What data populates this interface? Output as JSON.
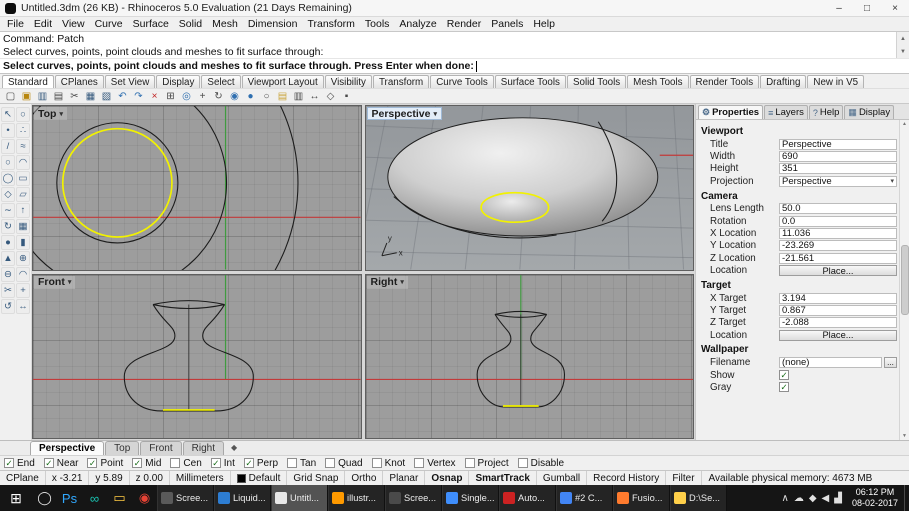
{
  "colors": {
    "selection": "#f2f200",
    "axis_x": "#c23a3a",
    "axis_y": "#3f9b3f",
    "curve": "#1c1c1c",
    "taskbar_bg": "#151515",
    "accent": "#2f6fb0"
  },
  "icons": {
    "check": "✓",
    "chevron_down": "▾",
    "scroll_up": "▲",
    "scroll_down": "▼",
    "viewport_menu": "◆"
  },
  "titlebar": {
    "title": "Untitled.3dm (26 KB) - Rhinoceros 5.0 Evaluation (21 Days Remaining)",
    "minimize": "–",
    "maximize": "□",
    "close": "×"
  },
  "menubar": {
    "items": [
      "File",
      "Edit",
      "View",
      "Curve",
      "Surface",
      "Solid",
      "Mesh",
      "Dimension",
      "Transform",
      "Tools",
      "Analyze",
      "Render",
      "Panels",
      "Help"
    ]
  },
  "command": {
    "history": [
      "Command: Patch",
      "Select curves, points, point clouds and meshes to fit surface through:"
    ],
    "prompt": "Select curves, points, point clouds and meshes to fit surface through. Press Enter when done:"
  },
  "toolbar_tabs": {
    "active": "Standard",
    "items": [
      "Standard",
      "CPlanes",
      "Set View",
      "Display",
      "Select",
      "Viewport Layout",
      "Visibility",
      "Transform",
      "Curve Tools",
      "Surface Tools",
      "Solid Tools",
      "Mesh Tools",
      "Render Tools",
      "Drafting",
      "New in V5"
    ]
  },
  "toolbar": {
    "icons": [
      {
        "name": "new-file",
        "glyph": "▢",
        "color": "#4a4a4a"
      },
      {
        "name": "open-file",
        "glyph": "▣",
        "color": "#b8860b"
      },
      {
        "name": "save-file",
        "glyph": "▥",
        "color": "#35597d"
      },
      {
        "name": "print",
        "glyph": "▤",
        "color": "#4a4a4a"
      },
      {
        "name": "cut",
        "glyph": "✂",
        "color": "#4a4a4a"
      },
      {
        "name": "copy",
        "glyph": "▦",
        "color": "#35597d"
      },
      {
        "name": "paste",
        "glyph": "▧",
        "color": "#35597d"
      },
      {
        "name": "undo",
        "glyph": "↶",
        "color": "#2f6fb0"
      },
      {
        "name": "redo",
        "glyph": "↷",
        "color": "#2f6fb0"
      },
      {
        "name": "delete",
        "glyph": "×",
        "color": "#c22525"
      },
      {
        "name": "select-all",
        "glyph": "⊞",
        "color": "#4a4a4a"
      },
      {
        "name": "zoom-extents",
        "glyph": "◎",
        "color": "#2f6fb0"
      },
      {
        "name": "pan-view",
        "glyph": "+",
        "color": "#4a4a4a"
      },
      {
        "name": "rotate-view",
        "glyph": "↻",
        "color": "#4a4a4a"
      },
      {
        "name": "zoom-window",
        "glyph": "◉",
        "color": "#2f6fb0"
      },
      {
        "name": "shaded-view",
        "glyph": "●",
        "color": "#2f6fb0"
      },
      {
        "name": "wireframe-view",
        "glyph": "○",
        "color": "#4a4a4a"
      },
      {
        "name": "layers-dialog",
        "glyph": "▤",
        "color": "#caa53d"
      },
      {
        "name": "object-properties",
        "glyph": "▥",
        "color": "#4a4a4a"
      },
      {
        "name": "distance",
        "glyph": "↔",
        "color": "#4a4a4a"
      },
      {
        "name": "hide-objects",
        "glyph": "◇",
        "color": "#4a4a4a"
      },
      {
        "name": "lock-objects",
        "glyph": "▪",
        "color": "#4a4a4a"
      }
    ]
  },
  "sidebar": {
    "tools": [
      {
        "name": "pointer-tool",
        "glyph": "↖"
      },
      {
        "name": "selection-filter-tool",
        "glyph": "○"
      },
      {
        "name": "point-tool",
        "glyph": "•"
      },
      {
        "name": "points-tool",
        "glyph": "∴"
      },
      {
        "name": "polyline-tool",
        "glyph": "/"
      },
      {
        "name": "curve-tool",
        "glyph": "≈"
      },
      {
        "name": "circle-tool",
        "glyph": "○"
      },
      {
        "name": "arc-tool",
        "glyph": "◠"
      },
      {
        "name": "ellipse-tool",
        "glyph": "◯"
      },
      {
        "name": "rectangle-tool",
        "glyph": "▭"
      },
      {
        "name": "polygon-tool",
        "glyph": "◇"
      },
      {
        "name": "surface-tool",
        "glyph": "▱"
      },
      {
        "name": "loft-tool",
        "glyph": "∼"
      },
      {
        "name": "extrude-tool",
        "glyph": "↑"
      },
      {
        "name": "revolve-tool",
        "glyph": "↻"
      },
      {
        "name": "box-tool",
        "glyph": "▦"
      },
      {
        "name": "sphere-tool",
        "glyph": "●"
      },
      {
        "name": "cylinder-tool",
        "glyph": "▮"
      },
      {
        "name": "cone-tool",
        "glyph": "▲"
      },
      {
        "name": "boolean-union-tool",
        "glyph": "⊕"
      },
      {
        "name": "boolean-difference-tool",
        "glyph": "⊖"
      },
      {
        "name": "fillet-tool",
        "glyph": "◠"
      },
      {
        "name": "trim-tool",
        "glyph": "✂"
      },
      {
        "name": "move-tool",
        "glyph": "+"
      },
      {
        "name": "rotate-tool",
        "glyph": "↺"
      },
      {
        "name": "scale-tool",
        "glyph": "↔"
      }
    ]
  },
  "viewports": {
    "top": {
      "label": "Top"
    },
    "perspective": {
      "label": "Perspective"
    },
    "front": {
      "label": "Front"
    },
    "right": {
      "label": "Right"
    }
  },
  "panel": {
    "tabs": [
      {
        "label": "Properties",
        "icon": "⚙",
        "active": true
      },
      {
        "label": "Layers",
        "icon": "≡",
        "active": false
      },
      {
        "label": "Help",
        "icon": "?",
        "active": false
      },
      {
        "label": "Display",
        "icon": "▦",
        "active": false
      }
    ],
    "sections": [
      {
        "title": "Viewport",
        "rows": [
          {
            "label": "Title",
            "value": "Perspective",
            "type": "field"
          },
          {
            "label": "Width",
            "value": "690",
            "type": "field"
          },
          {
            "label": "Height",
            "value": "351",
            "type": "field"
          },
          {
            "label": "Projection",
            "value": "Perspective",
            "type": "select"
          }
        ]
      },
      {
        "title": "Camera",
        "rows": [
          {
            "label": "Lens Length",
            "value": "50.0",
            "type": "field"
          },
          {
            "label": "Rotation",
            "value": "0.0",
            "type": "field"
          },
          {
            "label": "X Location",
            "value": "11.036",
            "type": "field"
          },
          {
            "label": "Y Location",
            "value": "-23.269",
            "type": "field"
          },
          {
            "label": "Z Location",
            "value": "-21.561",
            "type": "field"
          },
          {
            "label": "Location",
            "value": "Place...",
            "type": "button"
          }
        ]
      },
      {
        "title": "Target",
        "rows": [
          {
            "label": "X Target",
            "value": "3.194",
            "type": "field"
          },
          {
            "label": "Y Target",
            "value": "0.867",
            "type": "field"
          },
          {
            "label": "Z Target",
            "value": "-2.088",
            "type": "field"
          },
          {
            "label": "Location",
            "value": "Place...",
            "type": "button"
          }
        ]
      },
      {
        "title": "Wallpaper",
        "rows": [
          {
            "label": "Filename",
            "value": "(none)",
            "type": "file"
          },
          {
            "label": "Show",
            "checked": true,
            "type": "checkbox"
          },
          {
            "label": "Gray",
            "checked": true,
            "type": "checkbox"
          }
        ]
      }
    ]
  },
  "viewport_tabs": {
    "items": [
      {
        "label": "Perspective",
        "active": true
      },
      {
        "label": "Top",
        "active": false
      },
      {
        "label": "Front",
        "active": false
      },
      {
        "label": "Right",
        "active": false
      }
    ]
  },
  "osnap": {
    "items": [
      {
        "label": "End",
        "checked": true
      },
      {
        "label": "Near",
        "checked": true
      },
      {
        "label": "Point",
        "checked": true
      },
      {
        "label": "Mid",
        "checked": true
      },
      {
        "label": "Cen",
        "checked": false
      },
      {
        "label": "Int",
        "checked": true
      },
      {
        "label": "Perp",
        "checked": true
      },
      {
        "label": "Tan",
        "checked": false
      },
      {
        "label": "Quad",
        "checked": false
      },
      {
        "label": "Knot",
        "checked": false
      },
      {
        "label": "Vertex",
        "checked": false
      },
      {
        "label": "Project",
        "checked": false
      },
      {
        "label": "Disable",
        "checked": false
      }
    ]
  },
  "status": {
    "cplane_label": "CPlane",
    "coords": [
      "x -3.21",
      "y 5.89",
      "z 0.00"
    ],
    "units": "Millimeters",
    "layer": "Default",
    "toggles": [
      {
        "label": "Grid Snap",
        "bold": false
      },
      {
        "label": "Ortho",
        "bold": false
      },
      {
        "label": "Planar",
        "bold": false
      },
      {
        "label": "Osnap",
        "bold": true
      },
      {
        "label": "SmartTrack",
        "bold": true
      },
      {
        "label": "Gumball",
        "bold": false
      },
      {
        "label": "Record History",
        "bold": false
      },
      {
        "label": "Filter",
        "bold": false
      }
    ],
    "memory": "Available physical memory: 4673 MB"
  },
  "taskbar": {
    "start_glyph": "⊞",
    "pinned": [
      {
        "name": "cortana-search",
        "glyph": "◯",
        "color": "#e8e8e8"
      },
      {
        "name": "photoshop",
        "glyph": "Ps",
        "color": "#31a8ff"
      },
      {
        "name": "infinity-app",
        "glyph": "∞",
        "color": "#19c3b1"
      },
      {
        "name": "file-explorer",
        "glyph": "▭",
        "color": "#ffca44"
      },
      {
        "name": "chrome",
        "glyph": "◉",
        "color": "#e84335"
      }
    ],
    "windows": [
      {
        "label": "Scree...",
        "name": "screenshot-app-window",
        "color": "#5a5a5a",
        "active": false
      },
      {
        "label": "Liquid...",
        "name": "liquid-app-window",
        "color": "#2d7dd2",
        "active": false
      },
      {
        "label": "Untitl...",
        "name": "rhino-app-window",
        "color": "#e8e8e8",
        "active": true
      },
      {
        "label": "illustr...",
        "name": "illustrator-window",
        "color": "#ff9a00",
        "active": false
      },
      {
        "label": "Scree...",
        "name": "screen-recorder-window",
        "color": "#4a4a4a",
        "active": false
      },
      {
        "label": "Single...",
        "name": "single-window",
        "color": "#3f8efc",
        "active": false
      },
      {
        "label": "Auto...",
        "name": "autocad-window",
        "color": "#cc2222",
        "active": false
      },
      {
        "label": "#2 C...",
        "name": "chrome-window-2",
        "color": "#4285f4",
        "active": false
      },
      {
        "label": "Fusio...",
        "name": "fusion360-window",
        "color": "#ff7b2e",
        "active": false
      },
      {
        "label": "D:\\Se...",
        "name": "explorer-window",
        "color": "#ffd04a",
        "active": false
      }
    ],
    "tray": {
      "icons": [
        {
          "name": "hidden-icons-chevron",
          "glyph": "∧"
        },
        {
          "name": "onedrive-icon",
          "glyph": "☁"
        },
        {
          "name": "security-icon",
          "glyph": "◆"
        },
        {
          "name": "volume-icon",
          "glyph": "◀"
        },
        {
          "name": "network-icon",
          "glyph": "▟"
        }
      ],
      "time": "06:12 PM",
      "date": "08-02-2017"
    }
  }
}
